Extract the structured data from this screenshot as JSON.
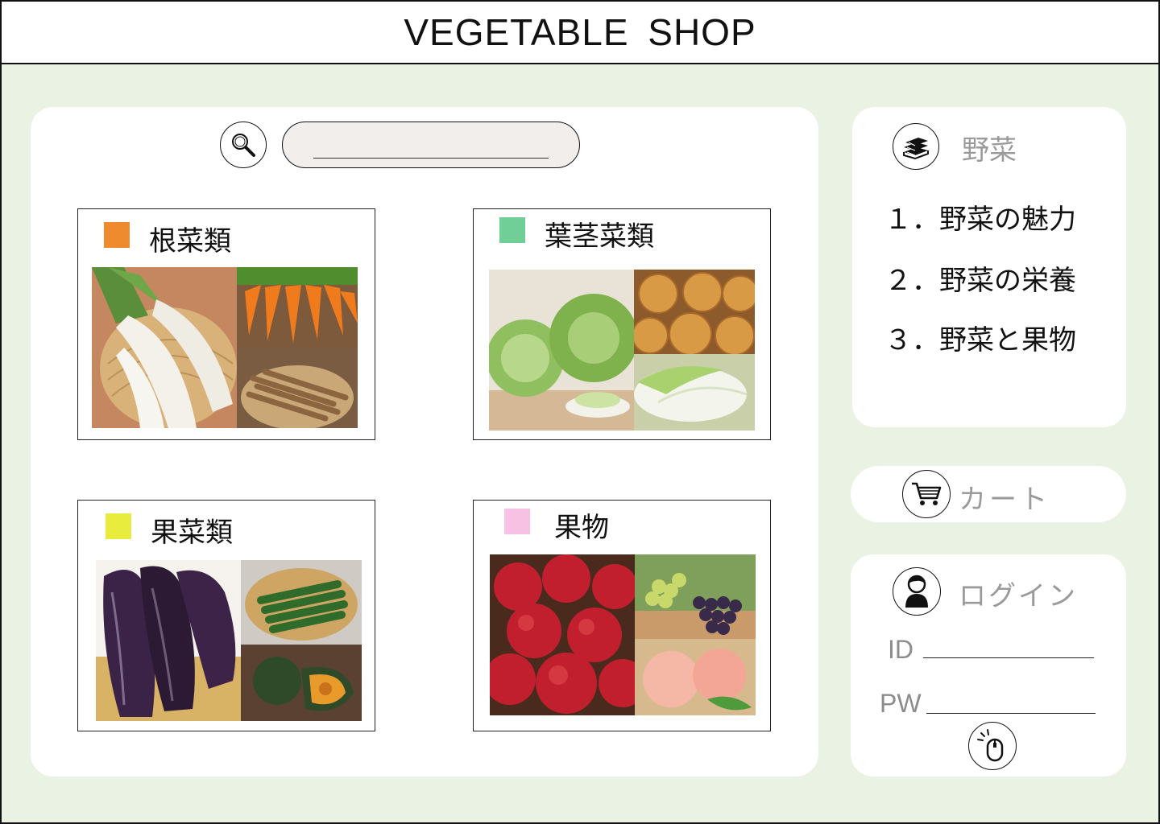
{
  "header": {
    "title": "VEGETABLE SHOP"
  },
  "search": {
    "placeholder": "",
    "value": ""
  },
  "categories": [
    {
      "label": "根菜類",
      "color": "#ef8a2e",
      "photos": [
        "daikon-photo",
        "carrot-photo",
        "burdock-photo"
      ]
    },
    {
      "label": "葉茎菜類",
      "color": "#6fcf97",
      "photos": [
        "cabbage-photo",
        "onion-photo",
        "hakusai-photo"
      ]
    },
    {
      "label": "果菜類",
      "color": "#e8ec3c",
      "photos": [
        "eggplant-photo",
        "cucumber-photo",
        "kabocha-photo"
      ]
    },
    {
      "label": "果物",
      "color": "#f7c1e4",
      "photos": [
        "apple-photo",
        "grape-photo",
        "peach-photo"
      ]
    }
  ],
  "vegetable_menu": {
    "title": "野菜",
    "icon": "books-icon",
    "items": [
      "１．野菜の魅力",
      "２．野菜の栄養",
      "３．野菜と果物"
    ]
  },
  "cart": {
    "label": "カート",
    "icon": "cart-icon"
  },
  "login": {
    "title": "ログイン",
    "icon": "user-icon",
    "id_label": "ID",
    "pw_label": "PW",
    "submit_icon": "mouse-click-icon"
  }
}
